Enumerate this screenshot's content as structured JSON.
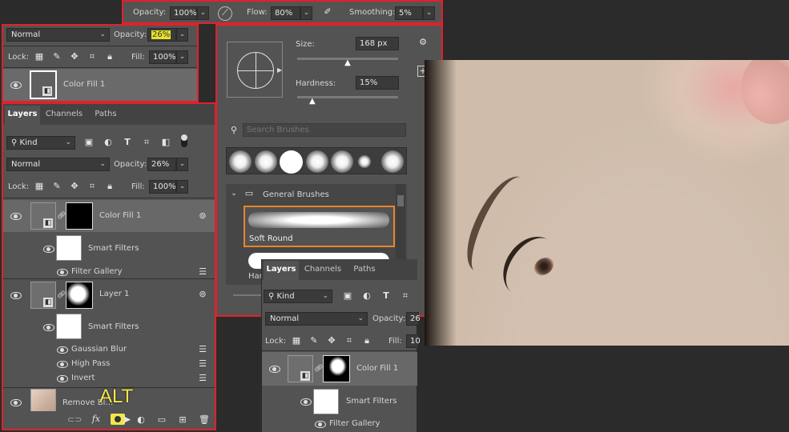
{
  "toolbar": {
    "opacity_label": "Opacity:",
    "opacity_value": "100%",
    "flow_label": "Flow:",
    "flow_value": "80%",
    "smoothing_label": "Smoothing:",
    "smoothing_value": "5%"
  },
  "props": {
    "blend_mode": "Normal",
    "opacity_label": "Opacity:",
    "opacity_value": "26%",
    "lock_label": "Lock:",
    "fill_label": "Fill:",
    "fill_value": "100%",
    "layer_name": "Color Fill 1"
  },
  "layers_panel": {
    "tabs": [
      "Layers",
      "Channels",
      "Paths"
    ],
    "kind_label": "Kind",
    "blend_mode": "Normal",
    "opacity_label": "Opacity:",
    "opacity_value": "26%",
    "lock_label": "Lock:",
    "fill_label": "Fill:",
    "fill_value": "100%",
    "layers": [
      {
        "name": "Color Fill 1",
        "smart_filters": "Smart Filters",
        "filters": [
          "Filter Gallery"
        ]
      },
      {
        "name": "Layer 1",
        "smart_filters": "Smart Filters",
        "filters": [
          "Gaussian Blur",
          "High Pass",
          "Invert"
        ]
      },
      {
        "name": "Remove Bl…"
      }
    ],
    "overlay_text": "ALT"
  },
  "brush_panel": {
    "size_label": "Size:",
    "size_value": "168 px",
    "size_level": 0.5,
    "hardness_label": "Hardness:",
    "hardness_value": "15%",
    "hardness_level": 0.15,
    "search_placeholder": "Search Brushes",
    "group_name": "General Brushes",
    "selected_brush": "Soft Round",
    "next_brush_partial": "Har"
  },
  "layers_panel_2": {
    "tabs": [
      "Layers",
      "Channels",
      "Paths"
    ],
    "kind_label": "Kind",
    "blend_mode": "Normal",
    "opacity_label": "Opacity:",
    "opacity_value": "26",
    "lock_label": "Lock:",
    "fill_label": "Fill:",
    "fill_value": "10",
    "layer_name": "Color Fill 1",
    "smart_filters": "Smart Filters",
    "filter": "Filter Gallery"
  },
  "colors": {
    "panel_bg": "#535353",
    "highlight_border": "#e3202a",
    "selected_brush_border": "#e8852a",
    "alt_text": "#f2e64a"
  }
}
